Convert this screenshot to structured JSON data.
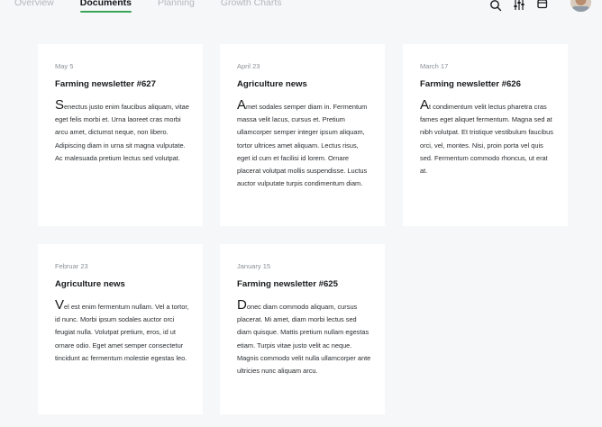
{
  "nav": {
    "items": [
      {
        "label": "Overview",
        "active": false
      },
      {
        "label": "Documents",
        "active": true
      },
      {
        "label": "Planning",
        "active": false
      },
      {
        "label": "Growth Charts",
        "active": false
      }
    ]
  },
  "toolbar": {
    "icons": [
      "search-icon",
      "sliders-icon",
      "calendar-icon"
    ],
    "active_tab_color": "#3aa55a"
  },
  "cards": [
    {
      "date": "May 5",
      "title": "Farming newsletter #627",
      "dropcap": "S",
      "body": "enectus justo enim faucibus aliquam, vitae eget felis morbi et. Urna laoreet cras morbi arcu amet, dictumst neque, non libero. Adipiscing diam in urna sit magna vulputate. Ac malesuada pretium lectus sed volutpat."
    },
    {
      "date": "April 23",
      "title": "Agriculture news",
      "dropcap": "A",
      "body": "met sodales semper diam in. Fermentum massa velit lacus, cursus et. Pretium ullamcorper semper integer ipsum aliquam, tortor ultrices amet aliquam. Lectus risus, eget id cum et facilisi id lorem. Ornare placerat volutpat mollis suspendisse. Luctus auctor vulputate turpis condimentum diam."
    },
    {
      "date": "March 17",
      "title": "Farming newsletter #626",
      "dropcap": "A",
      "body": "t condimentum velit lectus pharetra cras fames eget aliquet fermentum. Magna sed at nibh volutpat. Et tristique vestibulum faucibus orci, vel, montes. Nisi, proin porta vel quis sed. Fermentum commodo rhoncus, ut erat at."
    },
    {
      "date": "Februar 23",
      "title": "Agriculture news",
      "dropcap": "V",
      "body": "el est enim fermentum nullam. Vel a tortor, id nunc. Morbi ipsum sodales auctor orci feugiat nulla. Volutpat pretium, eros, id ut ornare odio. Eget amet semper consectetur tincidunt ac fermentum molestie egestas leo."
    },
    {
      "date": "January 15",
      "title": "Farming newsletter #625",
      "dropcap": "D",
      "body": "onec diam commodo aliquam, cursus placerat. Mi amet, diam morbi lectus sed diam quisque. Mattis pretium nullam egestas etiam. Turpis vitae justo velit ac neque. Magnis commodo velit nulla ullamcorper ante ultricies nunc aliquam arcu."
    }
  ]
}
